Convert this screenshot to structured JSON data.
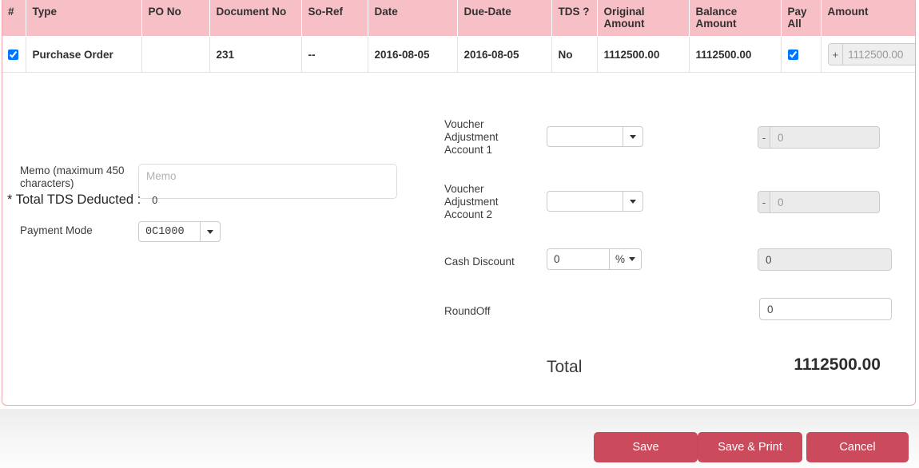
{
  "table": {
    "columns": [
      {
        "key": "num",
        "label": "#"
      },
      {
        "key": "type",
        "label": "Type"
      },
      {
        "key": "pono",
        "label": "PO No"
      },
      {
        "key": "docno",
        "label": "Document No"
      },
      {
        "key": "soref",
        "label": "So-Ref"
      },
      {
        "key": "date",
        "label": "Date"
      },
      {
        "key": "due",
        "label": "Due-Date"
      },
      {
        "key": "tds",
        "label": "TDS ?"
      },
      {
        "key": "orig",
        "label": "Original Amount"
      },
      {
        "key": "bal",
        "label": "Balance Amount"
      },
      {
        "key": "payall",
        "label": "Pay All"
      },
      {
        "key": "amount",
        "label": "Amount"
      }
    ],
    "rows": [
      {
        "selected": true,
        "type": "Purchase Order",
        "pono": "",
        "docno": "231",
        "soref": "--",
        "date": "2016-08-05",
        "due": "2016-08-05",
        "tds": "No",
        "orig": "1112500.00",
        "bal": "1112500.00",
        "payall": true,
        "amount_plus_label": "+",
        "amount_value": "1112500.00"
      }
    ]
  },
  "form": {
    "memo_label": "Memo (maximum 450 characters)",
    "memo_placeholder": "Memo",
    "memo_value": "",
    "payment_mode_label": "Payment Mode",
    "payment_mode_value": "0C1000",
    "tds_label": "* Total TDS Deducted :",
    "tds_value": "0",
    "voucher1_label": "Voucher Adjustment Account 1",
    "voucher1_select_value": "",
    "voucher1_sign": "-",
    "voucher1_amount_placeholder": "0",
    "voucher1_amount_value": "",
    "voucher2_label": "Voucher Adjustment Account 2",
    "voucher2_select_value": "",
    "voucher2_sign": "-",
    "voucher2_amount_placeholder": "0",
    "voucher2_amount_value": "",
    "cash_discount_label": "Cash Discount",
    "cash_discount_value": "0",
    "cash_discount_unit": "%",
    "cash_discount_amount": "0",
    "roundoff_label": "RoundOff",
    "roundoff_value": "0",
    "total_label": "Total",
    "total_value": "1112500.00"
  },
  "footer": {
    "save_label": "Save",
    "save_print_label": "Save & Print",
    "cancel_label": "Cancel"
  },
  "colors": {
    "header_pink": "#f7bfc6",
    "panel_border": "#f0a7b0",
    "button_red": "#cb4a5c"
  }
}
